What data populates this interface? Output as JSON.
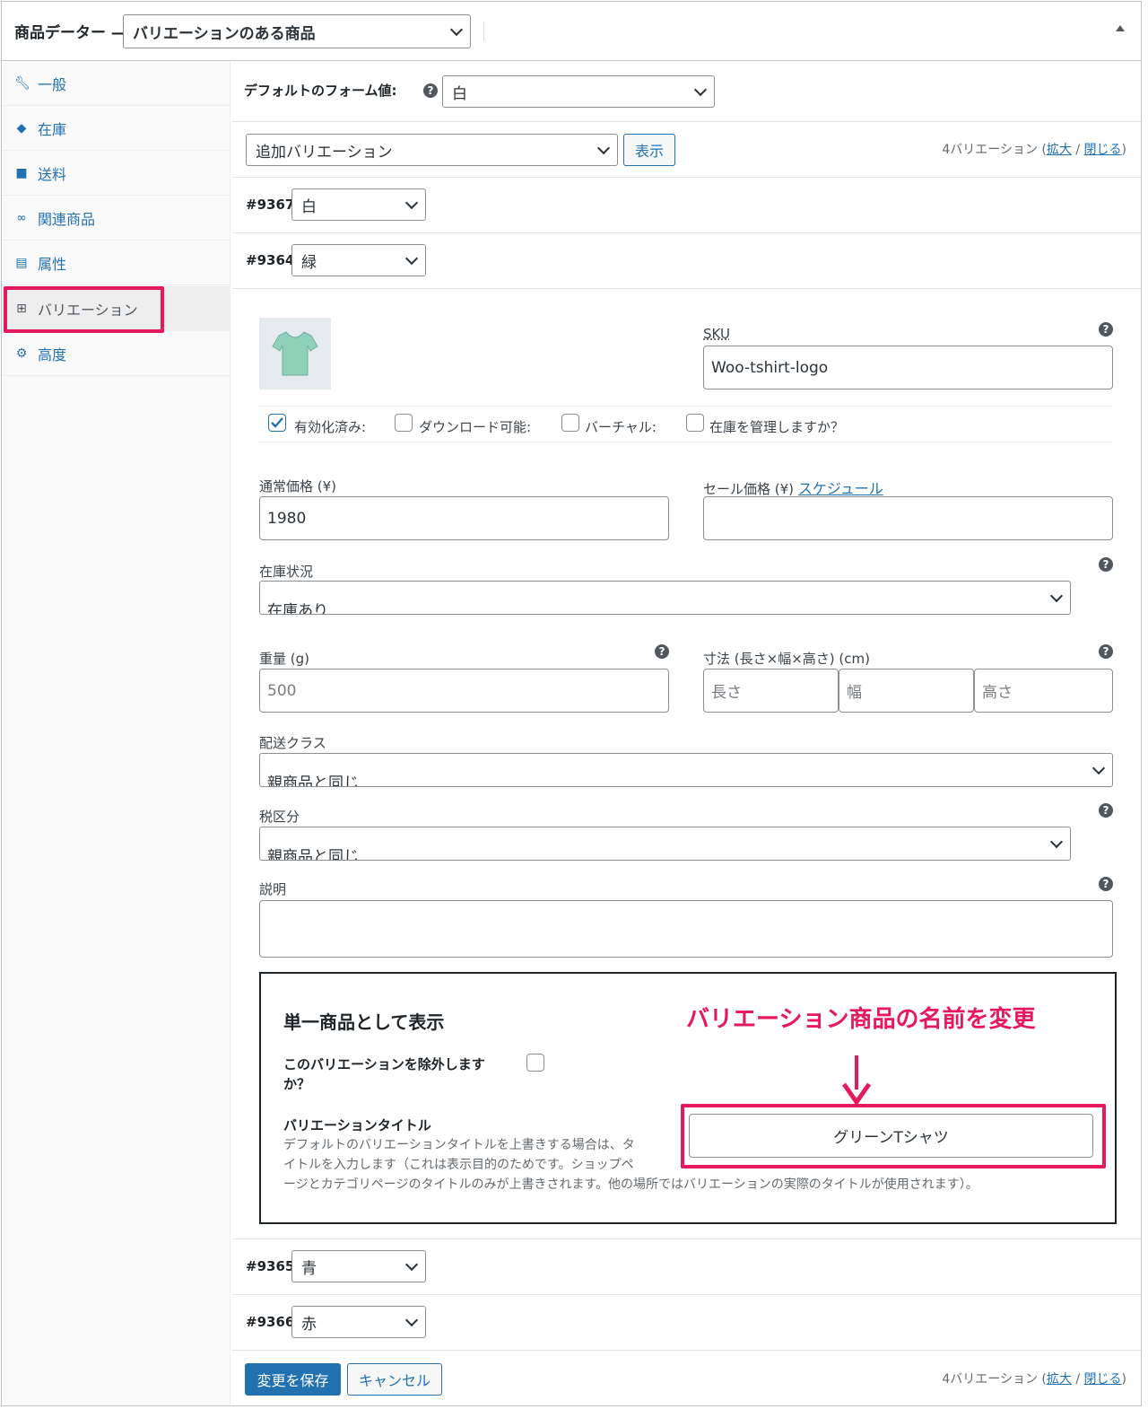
{
  "header": {
    "title": "商品データー",
    "product_type": "バリエーションのある商品"
  },
  "sidebar": {
    "items": [
      {
        "label": "一般",
        "icon": "wrench-icon"
      },
      {
        "label": "在庫",
        "icon": "tag-icon"
      },
      {
        "label": "送料",
        "icon": "truck-icon"
      },
      {
        "label": "関連商品",
        "icon": "link-icon"
      },
      {
        "label": "属性",
        "icon": "list-icon"
      },
      {
        "label": "バリエーション",
        "icon": "grid-icon"
      },
      {
        "label": "高度",
        "icon": "gear-icon"
      }
    ]
  },
  "defaults": {
    "label": "デフォルトのフォーム値:",
    "value": "白"
  },
  "toolbar": {
    "action": "追加バリエーション",
    "go": "表示",
    "count": "4バリエーション",
    "expand": "拡大",
    "close": "閉じる"
  },
  "variations": [
    {
      "id": "#9367",
      "value": "白"
    },
    {
      "id": "#9364",
      "value": "緑"
    },
    {
      "id": "#9365",
      "value": "青"
    },
    {
      "id": "#9366",
      "value": "赤"
    }
  ],
  "form": {
    "sku_label": "SKU",
    "sku_value": "Woo-tshirt-logo",
    "checks": {
      "enabled": "有効化済み:",
      "downloadable": "ダウンロード可能:",
      "virtual": "バーチャル:",
      "manage_stock": "在庫を管理しますか？"
    },
    "regular_price_label": "通常価格 (¥)",
    "regular_price": "1980",
    "sale_price_label": "セール価格 (¥)",
    "schedule": "スケジュール",
    "stock_status_label": "在庫状況",
    "stock_status": "在庫あり",
    "weight_label": "重量 (g)",
    "weight_placeholder": "500",
    "dimensions_label": "寸法 (長さ×幅×高さ) (cm)",
    "length_placeholder": "長さ",
    "width_placeholder": "幅",
    "height_placeholder": "高さ",
    "shipping_class_label": "配送クラス",
    "shipping_class": "親商品と同じ",
    "tax_class_label": "税区分",
    "tax_class": "親商品と同じ",
    "description_label": "説明"
  },
  "single": {
    "heading": "単一商品として表示",
    "exclude_label_1": "このバリエーションを除外します",
    "exclude_label_2": "か？",
    "title_label": "バリエーションタイトル",
    "desc_1": "デフォルトのバリエーションタイトルを上書きする場合は、タ",
    "desc_2": "イトルを入力します（これは表示目的のためです。ショップペ",
    "desc_3": "ージとカテゴリページのタイトルのみが上書きされます。他の場所ではバリエーションの実際のタイトルが使用されます）。",
    "title_value": "グリーンTシャツ"
  },
  "annotation": {
    "text": "バリエーション商品の名前を変更",
    "color": "#e6185f"
  },
  "footer": {
    "save": "変更を保存",
    "cancel": "キャンセル",
    "count": "4バリエーション",
    "expand": "拡大",
    "close": "閉じる"
  }
}
